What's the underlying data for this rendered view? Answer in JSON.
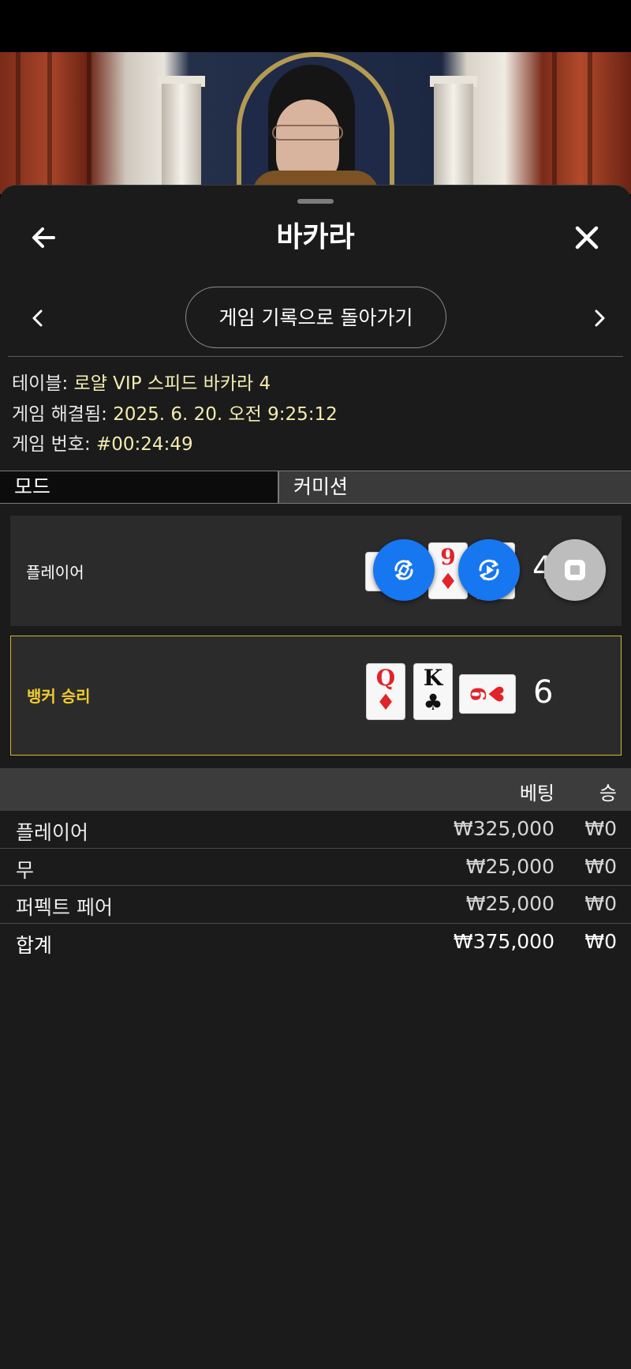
{
  "header": {
    "title": "바카라"
  },
  "navigation": {
    "back_to_history_label": "게임 기록으로 돌아가기"
  },
  "game_info": {
    "table_label": "테이블:",
    "table_value": "로얄 VIP 스피드 바카라 4",
    "resolved_label": "게임 해결됨:",
    "resolved_value": "2025. 6. 20. 오전 9:25:12",
    "number_label": "게임 번호:",
    "number_value": "#00:24:49"
  },
  "mode_row": {
    "mode_label": "모드",
    "mode_value": "커미션"
  },
  "hands": {
    "player": {
      "label": "플레이어",
      "score": "4",
      "cards": [
        {
          "rank": "",
          "suit": "",
          "color": "black"
        },
        {
          "rank": "9",
          "suit": "♦",
          "color": "red"
        },
        {
          "rank": "",
          "suit": "",
          "color": "black"
        }
      ]
    },
    "banker": {
      "label": "뱅커 승리",
      "score": "6",
      "cards": [
        {
          "rank": "Q",
          "suit": "♦",
          "color": "red"
        },
        {
          "rank": "K",
          "suit": "♣",
          "color": "black"
        },
        {
          "rank": "6",
          "suit": "♥",
          "color": "red"
        }
      ]
    }
  },
  "bets": {
    "header_bet": "베팅",
    "header_win": "승",
    "rows": [
      {
        "name": "플레이어",
        "amount": "₩325,000",
        "win": "₩0"
      },
      {
        "name": "무",
        "amount": "₩25,000",
        "win": "₩0"
      },
      {
        "name": "퍼펙트 페어",
        "amount": "₩25,000",
        "win": "₩0"
      }
    ],
    "total": {
      "name": "합계",
      "amount": "₩375,000",
      "win": "₩0"
    }
  },
  "colors": {
    "sheet_bg": "#1b1b1b",
    "info_value": "#f4ecb0",
    "banker_highlight": "#d4b627",
    "banker_label": "#f2cd2e",
    "float_blue": "#1677f0",
    "float_gray": "#bdbdbd",
    "card_red": "#e0242a"
  },
  "icons": {
    "back": "arrow-left-icon",
    "close": "close-x-icon",
    "prev": "chevron-left-icon",
    "next": "chevron-right-icon",
    "rotate": "rotate-icon",
    "replay": "replay-icon",
    "stop": "stop-icon"
  }
}
